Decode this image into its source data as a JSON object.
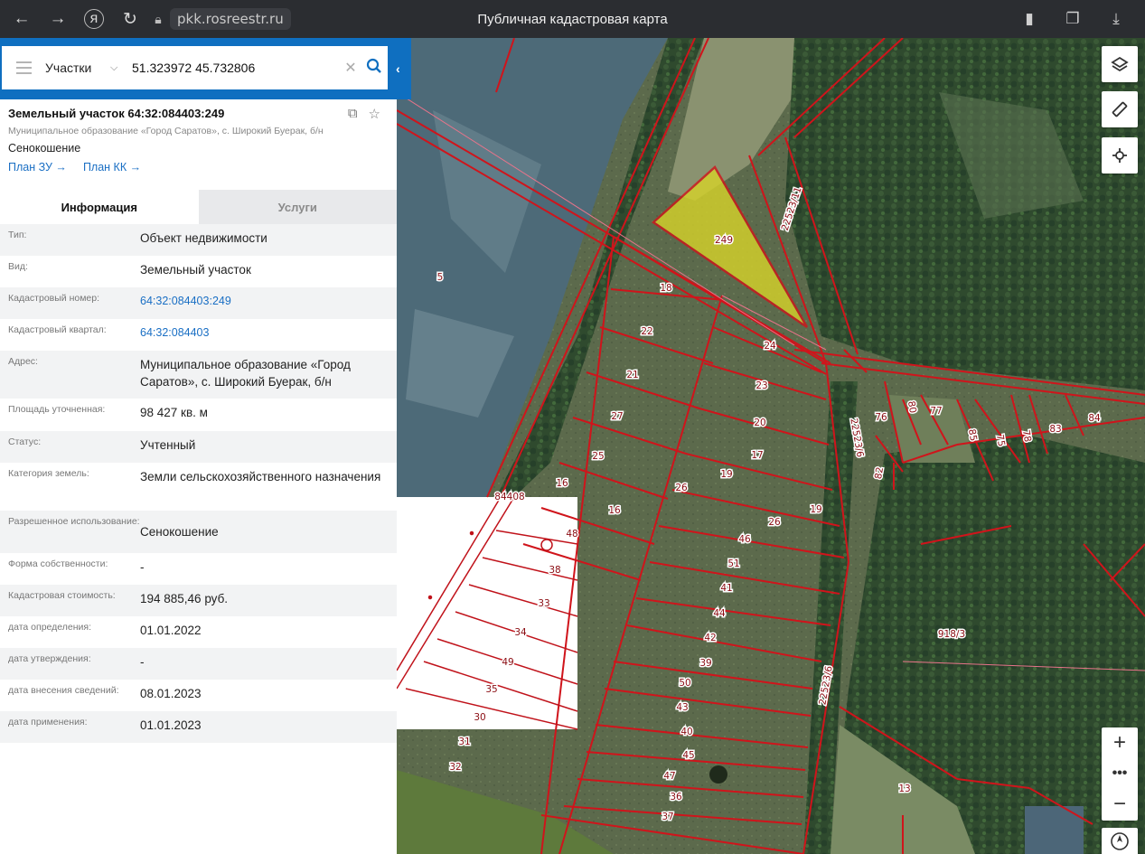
{
  "browser": {
    "url": "pkk.rosreestr.ru",
    "title": "Публичная кадастровая карта"
  },
  "search": {
    "type": "Участки",
    "query": "51.323972 45.732806"
  },
  "parcel": {
    "title": "Земельный участок 64:32:084403:249",
    "address": "Муниципальное образование «Город Саратов», с. Широкий Буерак, б/н",
    "use": "Сенокошение",
    "link_plan_zu": "План ЗУ →",
    "link_plan_kk": "План КК →"
  },
  "tabs": {
    "info": "Информация",
    "services": "Услуги"
  },
  "rows": [
    {
      "k": "Тип:",
      "v": "Объект недвижимости"
    },
    {
      "k": "Вид:",
      "v": "Земельный участок"
    },
    {
      "k": "Кадастровый номер:",
      "v": "64:32:084403:249"
    },
    {
      "k": "Кадастровый квартал:",
      "v": "64:32:084403"
    },
    {
      "k": "Адрес:",
      "v": "Муниципальное образование «Город Саратов», с. Широкий Буерак, б/н"
    },
    {
      "k": "Площадь уточненная:",
      "v": "98 427 кв. м"
    },
    {
      "k": "Статус:",
      "v": "Учтенный"
    },
    {
      "k": "Категория земель:",
      "v": "Земли сельскохозяйственного назначения"
    },
    {
      "k": "Разрешенное использование:",
      "v": "Сенокошение"
    },
    {
      "k": "Форма собственности:",
      "v": "-"
    },
    {
      "k": "Кадастровая стоимость:",
      "v": "194 885,46 руб."
    },
    {
      "k": "дата определения:",
      "v": "01.01.2022"
    },
    {
      "k": "дата утверждения:",
      "v": "-"
    },
    {
      "k": "дата внесения сведений:",
      "v": "08.01.2023"
    },
    {
      "k": "дата применения:",
      "v": "01.01.2023"
    }
  ],
  "map_labels": [
    "249",
    "5",
    "18",
    "22",
    "24",
    "21",
    "23",
    "27",
    "20",
    "25",
    "17",
    "16",
    "19",
    "26",
    "16",
    "19",
    "26",
    "46",
    "51",
    "41",
    "44",
    "42",
    "39",
    "50",
    "43",
    "40",
    "45",
    "47",
    "36",
    "37",
    "31",
    "32",
    "48",
    "38",
    "33",
    "34",
    "49",
    "35",
    "30",
    "84408",
    "76",
    "80",
    "77",
    "85",
    "75",
    "78",
    "83",
    "84",
    "82",
    "13",
    "918/3",
    "22523/11",
    "22523/6",
    "22523/6"
  ],
  "colors": {
    "accent": "#0f6fc0",
    "parcel_line": "#d0141b",
    "selected_fill": "#d7d42a"
  }
}
